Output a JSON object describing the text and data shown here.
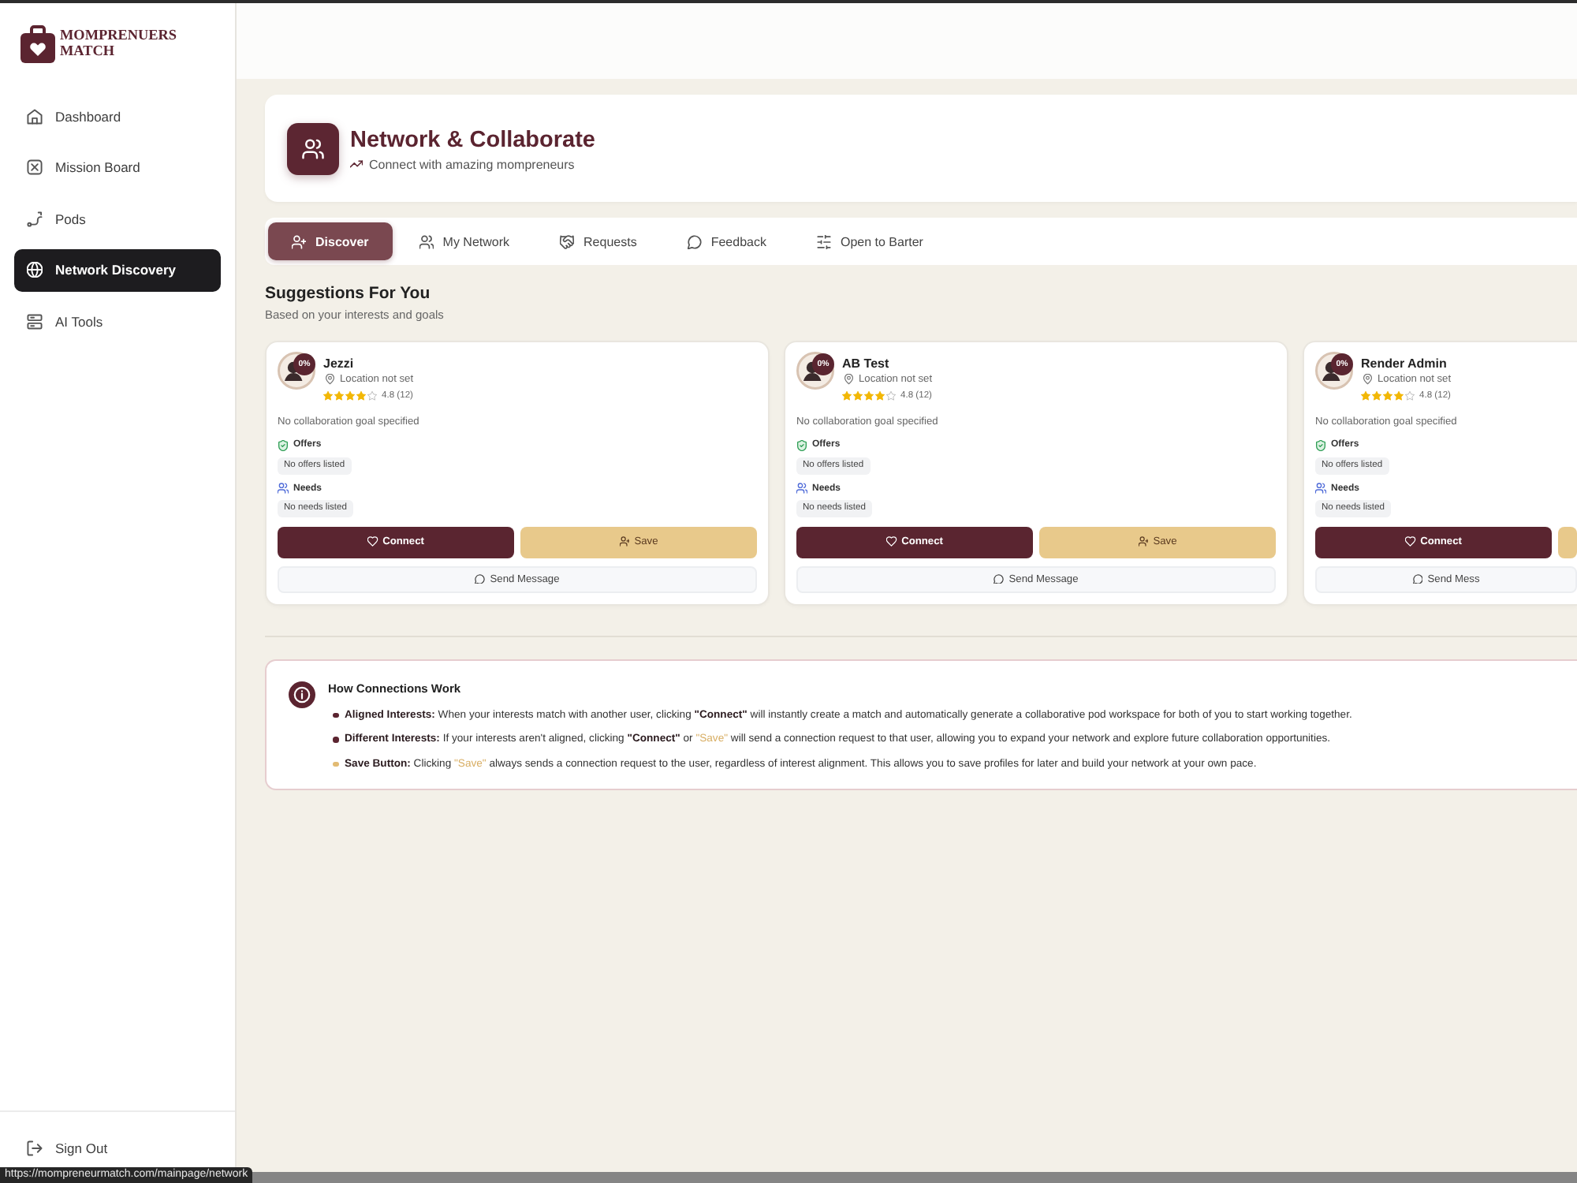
{
  "sidebar": {
    "brand": "MOMPRENUERS MATCH",
    "items": [
      {
        "label": "Dashboard",
        "selected": false
      },
      {
        "label": "Mission Board",
        "selected": false
      },
      {
        "label": "Pods",
        "selected": false
      },
      {
        "label": "Network Discovery",
        "selected": true
      },
      {
        "label": "AI Tools",
        "selected": false
      }
    ],
    "sign_out": "Sign Out"
  },
  "header": {
    "title": "Network & Collaborate",
    "subtitle": "Connect with amazing mompreneurs"
  },
  "tabs": [
    {
      "label": "Discover",
      "selected": true
    },
    {
      "label": "My Network",
      "selected": false
    },
    {
      "label": "Requests",
      "selected": false
    },
    {
      "label": "Feedback",
      "selected": false
    },
    {
      "label": "Open to Barter",
      "selected": false
    }
  ],
  "suggestions": {
    "title": "Suggestions For You",
    "subtitle": "Based on your interests and goals",
    "cards": [
      {
        "name": "Jezzi",
        "match": "0%",
        "location": "Location not set",
        "stars": 4,
        "rating": "4.8 (12)",
        "goal": "No collaboration goal specified",
        "offers_label": "Offers",
        "offers": "No offers listed",
        "needs_label": "Needs",
        "needs": "No needs listed",
        "connect": "Connect",
        "save": "Save",
        "message": "Send Message"
      },
      {
        "name": "AB Test",
        "match": "0%",
        "location": "Location not set",
        "stars": 4,
        "rating": "4.8 (12)",
        "goal": "No collaboration goal specified",
        "offers_label": "Offers",
        "offers": "No offers listed",
        "needs_label": "Needs",
        "needs": "No needs listed",
        "connect": "Connect",
        "save": "Save",
        "message": "Send Message"
      },
      {
        "name": "Render Admin",
        "match": "0%",
        "location": "Location not set",
        "stars": 4,
        "rating": "4.8 (12)",
        "goal": "No collaboration goal specified",
        "offers_label": "Offers",
        "offers": "No offers listed",
        "needs_label": "Needs",
        "needs": "No needs listed",
        "connect": "Connect",
        "message": "Send Mess"
      }
    ]
  },
  "info": {
    "title": "How Connections Work",
    "bullets": [
      {
        "color": "#5b2430",
        "parts": [
          {
            "kind": "term",
            "text": "Aligned Interests:"
          },
          {
            "kind": "text",
            "text": " When your interests match with another user, clicking "
          },
          {
            "kind": "action",
            "text": "\"Connect\""
          },
          {
            "kind": "text",
            "text": " will instantly create a match and automatically generate a collaborative pod workspace for both of you to start working together."
          }
        ]
      },
      {
        "color": "#5b2430",
        "parts": [
          {
            "kind": "term",
            "text": "Different Interests:"
          },
          {
            "kind": "text",
            "text": " If your interests aren't aligned, clicking "
          },
          {
            "kind": "action",
            "text": "\"Connect\""
          },
          {
            "kind": "text",
            "text": " or "
          },
          {
            "kind": "option",
            "text": "\"Save\""
          },
          {
            "kind": "text",
            "text": " will send a connection request to that user, allowing you to expand your network and explore future collaboration opportunities."
          }
        ]
      },
      {
        "color": "#e2bb73",
        "parts": [
          {
            "kind": "term",
            "text": "Save Button:"
          },
          {
            "kind": "text",
            "text": " Clicking "
          },
          {
            "kind": "option",
            "text": "\"Save\""
          },
          {
            "kind": "text",
            "text": " always sends a connection request to the user, regardless of interest alignment. This allows you to save profiles for later and build your network at your own pace."
          }
        ]
      }
    ]
  },
  "status_url": "https://mompreneurmatch.com/mainpage/network"
}
